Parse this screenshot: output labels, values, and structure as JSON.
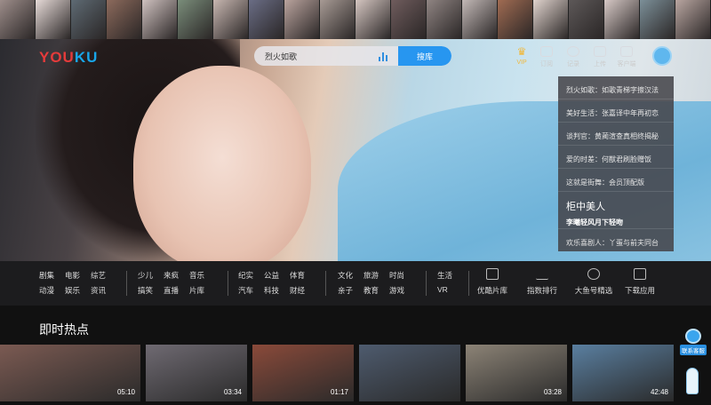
{
  "strip_colors": [
    "#9d8d8a",
    "#e6dad7",
    "#5e6a73",
    "#8c6a5c",
    "#cfc1bf",
    "#7a8d7a",
    "#c7b6b0",
    "#6a6d85",
    "#b9a39d",
    "#a79a94",
    "#d4c5c0",
    "#6f5c5d",
    "#8f8482",
    "#c2b8b6",
    "#a06b52",
    "#e0d3cd",
    "#5d5858",
    "#d6c8c5",
    "#7c8f98",
    "#b8a5a0"
  ],
  "header": {
    "logo_you": "YOU",
    "logo_ku": "KU",
    "search": {
      "value": "烈火如歌",
      "button": "搜库"
    },
    "nav": [
      {
        "name": "vip",
        "label": "VIP",
        "icon": "crown-icon"
      },
      {
        "name": "subscribe",
        "label": "订阅",
        "icon": "subscribe-icon"
      },
      {
        "name": "history",
        "label": "记录",
        "icon": "clock-icon"
      },
      {
        "name": "upload",
        "label": "上传",
        "icon": "upload-icon"
      },
      {
        "name": "client",
        "label": "客户端",
        "icon": "monitor-icon"
      }
    ]
  },
  "hero_list": {
    "items": [
      "烈火如歌：如歌青梯字擦汉法",
      "美好生活：张嘉译中年再初恋",
      "谈判官：黄蔺渲查真相终揭秘",
      "爱的时差：何猷君刷脸赠饭",
      "这就是街舞：会员顶配版"
    ],
    "featured_title": "柜中美人",
    "featured_sub": "李曦轻风月下轻吻",
    "last": "欢乐喜剧人：丫蛋与前夫同台"
  },
  "categories": [
    [
      "剧集",
      "动漫",
      "电影",
      "娱乐",
      "综艺",
      "资讯"
    ],
    [
      "少儿",
      "搞笑",
      "来疯",
      "直播",
      "音乐",
      "片库"
    ],
    [
      "纪实",
      "汽车",
      "公益",
      "科技",
      "体育",
      "财经"
    ],
    [
      "文化",
      "亲子",
      "旅游",
      "教育",
      "时尚",
      "游戏"
    ],
    [
      "生活",
      "VR"
    ]
  ],
  "tools": [
    {
      "label": "优酷片库",
      "icon": "library-icon"
    },
    {
      "label": "指数排行",
      "icon": "chart-icon"
    },
    {
      "label": "大鱼号精选",
      "icon": "fish-icon"
    },
    {
      "label": "下载应用",
      "icon": "download-icon"
    }
  ],
  "section_title": "即时热点",
  "thumbs": [
    {
      "duration": "05:10",
      "color": "#7b5a52"
    },
    {
      "duration": "03:34",
      "color": "#6f6a72"
    },
    {
      "duration": "01:17",
      "color": "#8a4a3a"
    },
    {
      "duration": "",
      "color": "#4e5b6e"
    },
    {
      "duration": "03:28",
      "color": "#8c8376"
    },
    {
      "duration": "42:48",
      "color": "#5a7fa0"
    }
  ],
  "feedback": "联系客服"
}
